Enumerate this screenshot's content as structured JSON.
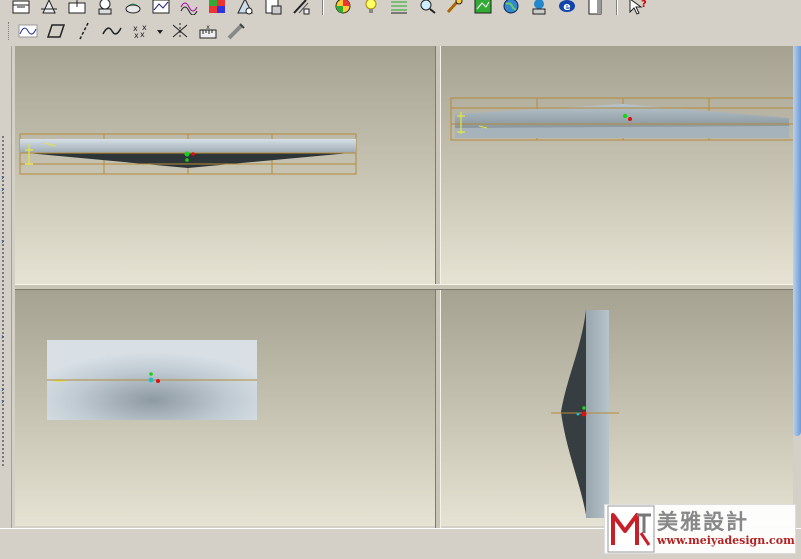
{
  "toolbar_top": [
    "datum-plane-icon",
    "datum-axis-icon",
    "datum-curve-icon",
    "datum-point-icon",
    "coordinate-system-icon",
    "analysis-icon",
    "curve-analysis-icon",
    "surface-analysis-icon",
    "color-analysis-icon",
    "draft-analysis-icon",
    "save-analysis-icon",
    "measure-icon",
    "appearance-icon",
    "light-icon",
    "grid-icon",
    "magnifier-icon",
    "sketch-tool-icon",
    "map-icon",
    "globe-icon",
    "web-icon",
    "browser-icon",
    "document-icon",
    "help-pointer-icon"
  ],
  "toolbar_second": [
    "wave-curve-icon",
    "parallelogram-icon",
    "line-icon",
    "spline-icon",
    "point-cross-icon",
    "dropdown-arrow-icon",
    "intersect-icon",
    "ruler-icon",
    "brush-icon"
  ],
  "viewports": [
    "view-top-left",
    "view-top-right",
    "view-bottom-left",
    "view-bottom-right"
  ],
  "colors": {
    "viewport_top": "#a6a292",
    "viewport_bottom": "#e6e3d4",
    "bounding_box": "#b58a3a",
    "model_light": "#b8c6cf",
    "model_dark": "#3c4448",
    "accent_green": "#1ad11a",
    "accent_red": "#e01010"
  },
  "watermark": {
    "chinese": "美雅設計",
    "url": "www.meiyadesign.com"
  }
}
